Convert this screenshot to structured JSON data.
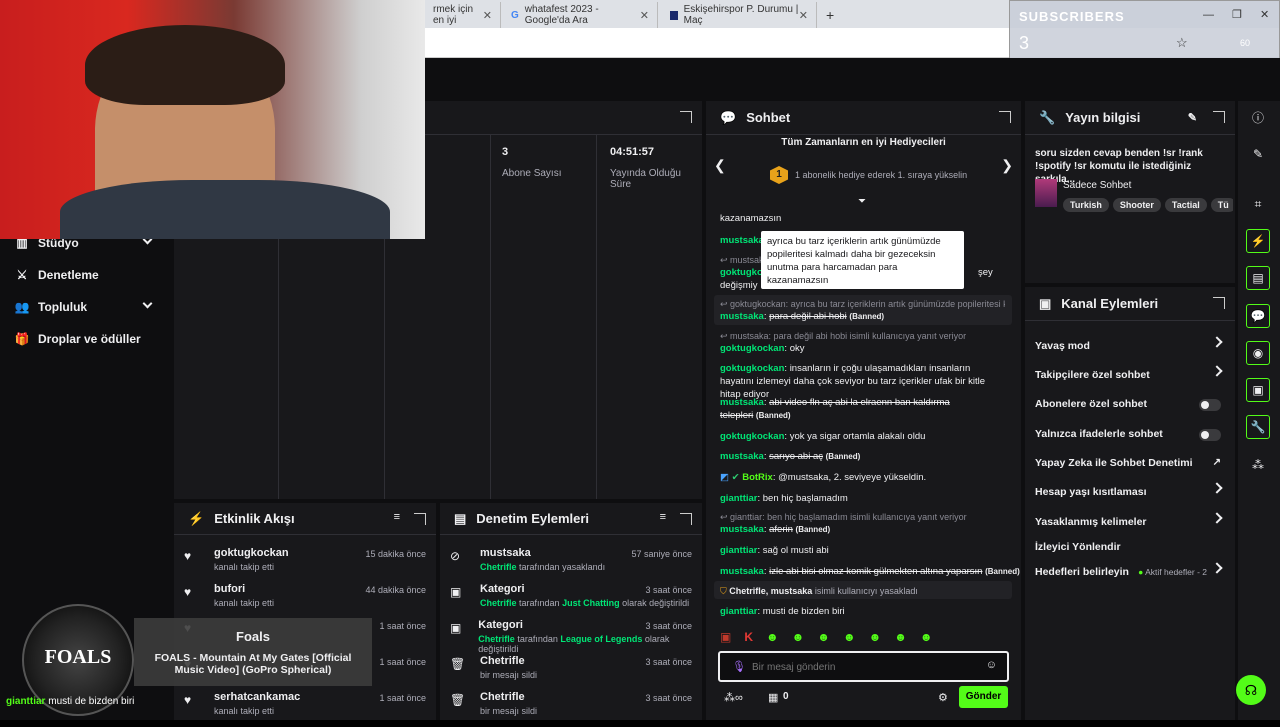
{
  "browser": {
    "tabs": [
      {
        "label": "rmek için en iyi"
      },
      {
        "label": "whatafest 2023 - Google'da Ara"
      },
      {
        "label": "Eskişehirspor P. Durumu | Maç"
      }
    ],
    "new_tab": "+"
  },
  "overlay": {
    "subscribers_title": "SUBSCRIBERS",
    "subscribers_count": "3",
    "progress": 0.98,
    "battery": "60"
  },
  "left_nav": {
    "items": [
      {
        "label": "Stüdyo",
        "icon": "chart-icon"
      },
      {
        "label": "Denetleme",
        "icon": "sword-icon"
      },
      {
        "label": "Topluluk",
        "icon": "people-icon"
      },
      {
        "label": "Droplar ve ödüller",
        "icon": "gift-icon"
      }
    ]
  },
  "stats": {
    "subs_value": "3",
    "subs_label": "Abone Sayısı",
    "live_value": "04:51:57",
    "live_label": "Yayında Olduğu Süre"
  },
  "activity": {
    "title": "Etkinlik Akışı",
    "items": [
      {
        "name": "goktugkockan",
        "sub": "kanalı takip etti",
        "time": "15 dakika önce"
      },
      {
        "name": "bufori",
        "sub": "kanalı takip etti",
        "time": "44 dakika önce"
      },
      {
        "name": "",
        "sub": "",
        "time": "1 saat önce"
      },
      {
        "name": "",
        "sub": "",
        "time": "1 saat önce"
      },
      {
        "name": "serhatcankamac",
        "sub": "kanalı takip etti",
        "time": "1 saat önce"
      }
    ]
  },
  "mod_actions": {
    "title": "Denetim Eylemleri",
    "items": [
      {
        "name": "mustsaka",
        "actor": "Chetrifle",
        "text": "tarafından yasaklandı",
        "extra": "",
        "suffix": "",
        "time": "57 saniye önce"
      },
      {
        "name": "Kategori",
        "actor": "Chetrifle",
        "text": "tarafından",
        "extra": "Just Chatting",
        "suffix": "olarak değiştirildi",
        "time": "3 saat önce"
      },
      {
        "name": "Kategori",
        "actor": "Chetrifle",
        "text": "tarafından",
        "extra": "League of Legends",
        "suffix": "olarak değiştirildi",
        "time": "3 saat önce"
      },
      {
        "name": "Chetrifle",
        "actor": "",
        "text": "bir mesajı sildi",
        "extra": "",
        "suffix": "",
        "time": "3 saat önce"
      },
      {
        "name": "Chetrifle",
        "actor": "",
        "text": "bir mesajı sildi",
        "extra": "",
        "suffix": "",
        "time": "3 saat önce"
      }
    ]
  },
  "chat": {
    "title": "Sohbet",
    "leaderboard_title": "Tüm Zamanların en iyi Hediyecileri",
    "leaderboard_rank": "1",
    "leaderboard_text": "1 abonelik hediye ederek 1. sıraya yükselin",
    "tooltip": "ayrıca bu tarz içeriklerin artık günümüzde popileritesi kalmadı daha bir gezeceksin unutma para harcamadan para kazanamazsın",
    "partial_top": "kazanamazsın",
    "lines": {
      "l1_user": "mustsaka",
      "l2_reply": "mustsaka",
      "l3_user": "goktugkock",
      "l3_text": "değişmiy",
      "l3_tail": "şey",
      "l4_reply": "goktugkockan: ayrıca bu tarz içeriklerin artık günümüzde popileritesi k...",
      "l4_user": "mustsaka",
      "l4_text": "para değil abi hobi",
      "l5_reply": "mustsaka: para değil abi hobi isimli kullanıcıya yanıt veriyor",
      "l5_user": "goktugkockan",
      "l5_text": "oky",
      "l6_user": "goktugkockan",
      "l6_text": "insanların ir çoğu ulaşamadıkları insanların hayatını izlemeyi daha çok seviyor bu tarz içerikler ufak bir kitle hitap ediyor",
      "l7_user": "mustsaka",
      "l7_text": "abi video fln aç abi la elraenn ban kaldırma telepleri",
      "l8_user": "goktugkockan",
      "l8_text": "yok ya sigar ortamla alakalı oldu",
      "l9_user": "mustsaka",
      "l9_text": "sarıyo abi aç",
      "l10_user": "BotRix",
      "l10_text": "@mustsaka, 2. seviyeye yükseldin.",
      "l11_user": "gianttiar",
      "l11_text": "ben hiç başlamadım",
      "l12_reply": "gianttiar: ben hiç başlamadım isimli kullanıcıya yanıt veriyor",
      "l12_user": "mustsaka",
      "l12_text": "aferin",
      "l13_user": "gianttiar",
      "l13_text": "sağ ol musti abi",
      "l14_user": "mustsaka",
      "l14_text": "izle abi bisi olmaz komik gülmekten altına yaparsın",
      "l15_text": "Chetrifle, mustsaka",
      "l15_tail": "isimli kullanıcıyı yasakladı",
      "l16_user": "gianttiar",
      "l16_text": "musti de bizden biri",
      "banned": "(Banned)"
    },
    "input_placeholder": "Bir mesaj gönderin",
    "points": "0",
    "send_label": "Gönder"
  },
  "stream_info": {
    "title": "Yayın bilgisi",
    "description": "soru sizden cevap benden !sr !rank !spotify !sr komutu ile istediğiniz şarkıla...",
    "category": "Sadece Sohbet",
    "tags": [
      "Turkish",
      "Shooter",
      "Tactial",
      "Tü"
    ]
  },
  "channel_actions": {
    "title": "Kanal Eylemleri",
    "items": [
      {
        "label": "Yavaş mod",
        "control": "chevron"
      },
      {
        "label": "Takipçilere özel sohbet",
        "control": "chevron"
      },
      {
        "label": "Abonelere özel sohbet",
        "control": "toggle"
      },
      {
        "label": "Yalnızca ifadelerle sohbet",
        "control": "toggle"
      },
      {
        "label": "Yapay Zeka ile Sohbet Denetimi",
        "control": "external"
      },
      {
        "label": "Hesap yaşı kısıtlaması",
        "control": "chevron"
      },
      {
        "label": "Yasaklanmış kelimeler",
        "control": "chevron"
      },
      {
        "label": "İzleyici Yönlendir",
        "control": "none"
      },
      {
        "label": "Hedefleri belirleyin",
        "control": "chevron"
      }
    ],
    "goals_status": "Aktif hedefler - 2"
  },
  "music": {
    "title": "Foals",
    "subtitle": "FOALS - Mountain At My Gates [Official Music Video] (GoPro Spherical)"
  },
  "bottom_chat": {
    "user": "gianttiar",
    "text": "musti de bizden biri"
  },
  "colors": {
    "accent": "#53fc18",
    "username": "#00e676",
    "panel": "#18181b",
    "progress": "#3a2bd8"
  }
}
